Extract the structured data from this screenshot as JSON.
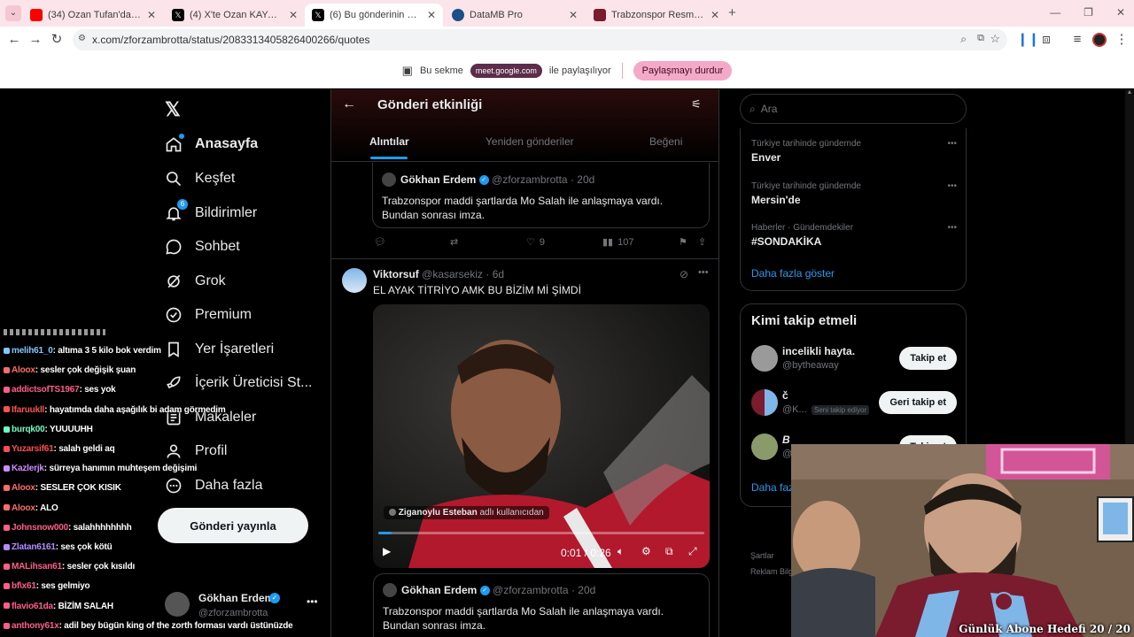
{
  "browser": {
    "tabs": [
      {
        "label": "(34) Ozan Tufan'dan 61saat'e o...",
        "favicon_color": "#ff0000",
        "active": false
      },
      {
        "label": "(4) X'te Ozan KAYA: \"Valla gereki...",
        "favicon_color": "#000000",
        "active": false
      },
      {
        "label": "(6) Bu gönderinin alıntıları...",
        "favicon_color": "#000000",
        "active": true
      },
      {
        "label": "DataMB Pro",
        "favicon_color": "#1a4f8a",
        "active": false
      },
      {
        "label": "Trabzonspor Resmi Alışveriş Sit...",
        "favicon_color": "#7a1b2e",
        "active": false
      }
    ],
    "url": "x.com/zforzambrotta/status/2083313405826400266/quotes"
  },
  "share_bar": {
    "prefix": "Bu sekme",
    "chip": "meet.google.com",
    "suffix": "ile paylaşılıyor",
    "stop_label": "Paylaşmayı durdur"
  },
  "sidebar": {
    "items": [
      {
        "label": "Anasayfa",
        "icon": "home-icon"
      },
      {
        "label": "Keşfet",
        "icon": "search-icon"
      },
      {
        "label": "Bildirimler",
        "icon": "bell-icon",
        "badge": "6"
      },
      {
        "label": "Sohbet",
        "icon": "chat-icon"
      },
      {
        "label": "Grok",
        "icon": "grok-icon"
      },
      {
        "label": "Premium",
        "icon": "premium-icon"
      },
      {
        "label": "Yer İşaretleri",
        "icon": "bookmark-icon"
      },
      {
        "label": "İçerik Üreticisi St...",
        "icon": "rocket-icon"
      },
      {
        "label": "Makaleler",
        "icon": "article-icon"
      },
      {
        "label": "Profil",
        "icon": "person-icon"
      },
      {
        "label": "Daha fazla",
        "icon": "more-circle-icon"
      }
    ],
    "post_button": "Gönderi yayınla",
    "account": {
      "name": "Gökhan Erdem",
      "handle": "@zforzambrotta"
    }
  },
  "header": {
    "title": "Gönderi etkinliği",
    "tabs": [
      "Alıntılar",
      "Yeniden gönderiler",
      "Beğeni"
    ]
  },
  "feed": {
    "quoted_post": {
      "name": "Gökhan Erdem",
      "handle": "@zforzambrotta",
      "time": "20d",
      "text": "Trabzonspor maddi şartlarda Mo Salah ile anlaşmaya vardı. Bundan sonrası imza."
    },
    "first_actions": {
      "likes": "9",
      "views": "107"
    },
    "post": {
      "name": "Viktorsuf",
      "handle": "@kasarsekiz",
      "time": "6d",
      "text": "EL AYAK TİTRİYO AMK BU BİZİM Mİ ŞİMDİ",
      "video_credit_user": "Ziganoylu Esteban",
      "video_credit_suffix": "adlı kullanıcıdan",
      "video_time": "0:01 / 0:26",
      "progress": 0.04
    },
    "nested_quote": {
      "name": "Gökhan Erdem",
      "handle": "@zforzambrotta",
      "time": "20d",
      "text": "Trabzonspor maddi şartlarda Mo Salah ile anlaşmaya vardı. Bundan sonrası imza."
    }
  },
  "right": {
    "search_placeholder": "Ara",
    "trends": [
      {
        "category": "Türkiye tarihinde gündemde",
        "name": "Enver"
      },
      {
        "category": "Türkiye tarihinde gündemde",
        "name": "Mersin'de"
      },
      {
        "category": "Haberler · Gündemdekiler",
        "name": "#SONDAKİKA"
      }
    ],
    "show_more": "Daha fazla göster",
    "who_to_follow_title": "Kimi takip etmeli",
    "suggestions": [
      {
        "name": "incelikli hayta.",
        "handle": "@bytheaway",
        "button": "Takip et",
        "badge": ""
      },
      {
        "name": "č",
        "handle": "@K...",
        "button": "Geri takip et",
        "badge": "Seni takip ediyor"
      },
      {
        "name": "B",
        "handle": "@",
        "button": "Takip et",
        "badge": ""
      }
    ],
    "show_more_2": "Daha fazla",
    "footer": [
      "Şartlar",
      "Reklam Bilgi"
    ]
  },
  "chat": {
    "messages": [
      {
        "user": "melih61_0",
        "text": ": altıma 3 5 kilo bok verdim",
        "color": "#7ec8ff"
      },
      {
        "user": "Aloox",
        "text": ": sesler çok değişik şuan",
        "color": "#ff6a6a"
      },
      {
        "user": "addictsofTS1967",
        "text": ": ses yok",
        "color": "#ff5c8a"
      },
      {
        "user": "Ifaruukll",
        "text": ": hayatımda daha aşağılık bi adam görmedim",
        "color": "#ff5050"
      },
      {
        "user": "burqk00",
        "text": ": YUUUUHH",
        "color": "#6affc2"
      },
      {
        "user": "Yuzarsif61",
        "text": ": salah geldi aq",
        "color": "#ff4d4d"
      },
      {
        "user": "Kazlerjk",
        "text": ": sürreya hanımın muhteşem değişimi",
        "color": "#d08bff"
      },
      {
        "user": "Aloox",
        "text": ": SESLER ÇOK KISIK",
        "color": "#ff6a6a"
      },
      {
        "user": "Aloox",
        "text": ": ALO",
        "color": "#ff6a6a"
      },
      {
        "user": "Johnsnow000",
        "text": ": salahhhhhhhh",
        "color": "#ff5c8a"
      },
      {
        "user": "Zlatan6161",
        "text": ": ses çok kötü",
        "color": "#b48aff"
      },
      {
        "user": "MALihsan61",
        "text": ": sesler çok kısıldı",
        "color": "#ff5c8a"
      },
      {
        "user": "bf\\x61",
        "text": ": ses gelmiyo",
        "color": "#ff5c8a"
      },
      {
        "user": "flavio61da",
        "text": ": BİZİM SALAH",
        "color": "#ff5c8a"
      },
      {
        "user": "anthony61x",
        "text": ": adil bey bügün king of the zorth forması vardı üstünüzde",
        "color": "#ff5c8a"
      }
    ]
  },
  "overlay": {
    "goal_text": "Günlük Abone Hedefi 20 / 20"
  }
}
